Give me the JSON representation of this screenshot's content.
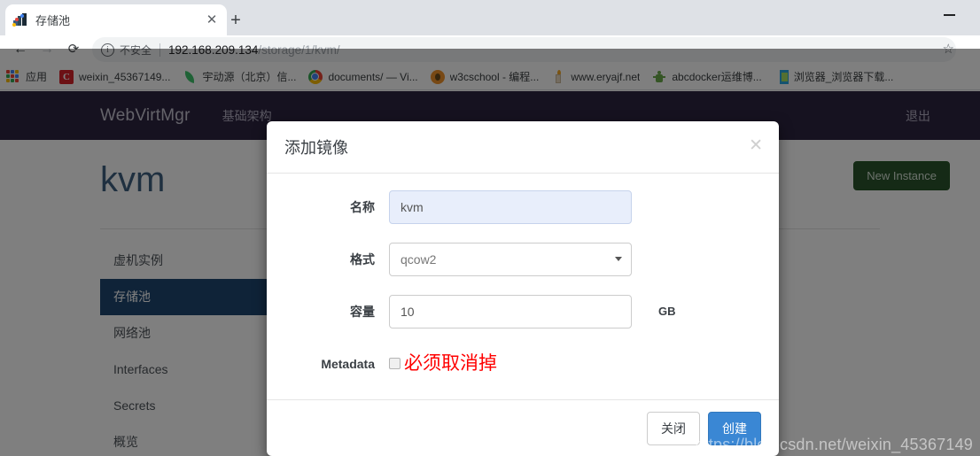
{
  "browser": {
    "tab": {
      "title": "存储池",
      "favicon": "chart-favicon-icon",
      "close_label": "✕"
    },
    "new_tab_label": "+",
    "window": {
      "minimize_label": "—"
    },
    "nav": {
      "back": "←",
      "forward": "→",
      "reload": "⟳"
    },
    "omnibox": {
      "info_icon": "ⓘ",
      "security_label": "不安全",
      "url_host": "192.168.209.134",
      "url_path": "/storage/1/kvm/",
      "star_icon": "☆"
    },
    "bookmarks": [
      {
        "label": "应用",
        "icon": "apps-grid-icon"
      },
      {
        "label": "weixin_45367149...",
        "icon": "csdn-icon"
      },
      {
        "label": "宇动源（北京）信...",
        "icon": "green-leaf-icon"
      },
      {
        "label": "documents/ — Vi...",
        "icon": "chrome-icon"
      },
      {
        "label": "w3cschool - 编程...",
        "icon": "w3cschool-icon"
      },
      {
        "label": "www.eryajf.net",
        "icon": "candle-icon"
      },
      {
        "label": "abcdocker运维博...",
        "icon": "abcdocker-icon"
      },
      {
        "label": "浏览器_浏览器下载...",
        "icon": "browser-icon"
      }
    ]
  },
  "app": {
    "brand": "WebVirtMgr",
    "nav_link": "基础架构",
    "logout": "退出",
    "page_title": "kvm",
    "new_instance_button": "New Instance",
    "sidebar": [
      {
        "label": "虚机实例",
        "active": false
      },
      {
        "label": "存储池",
        "active": true
      },
      {
        "label": "网络池",
        "active": false
      },
      {
        "label": "Interfaces",
        "active": false
      },
      {
        "label": "Secrets",
        "active": false
      },
      {
        "label": "概览",
        "active": false
      }
    ]
  },
  "modal": {
    "title": "添加镜像",
    "close_icon": "✕",
    "fields": {
      "name": {
        "label": "名称",
        "value": "kvm"
      },
      "format": {
        "label": "格式",
        "value": "qcow2",
        "caret": "▾"
      },
      "capacity": {
        "label": "容量",
        "value": "10",
        "unit": "GB"
      },
      "metadata": {
        "label": "Metadata",
        "checked": false,
        "annotation": "必须取消掉"
      }
    },
    "buttons": {
      "close": "关闭",
      "create": "创建"
    }
  },
  "watermark": "https://blog.csdn.net/weixin_45367149",
  "colors": {
    "navbar": "#2d2540",
    "sidebar_active": "#1f4770",
    "primary_button": "#3a87d4",
    "new_instance_button": "#2b542c",
    "annotation_red": "#ff0000",
    "page_title": "#3f6081",
    "autofill_field": "#e8eefb"
  }
}
